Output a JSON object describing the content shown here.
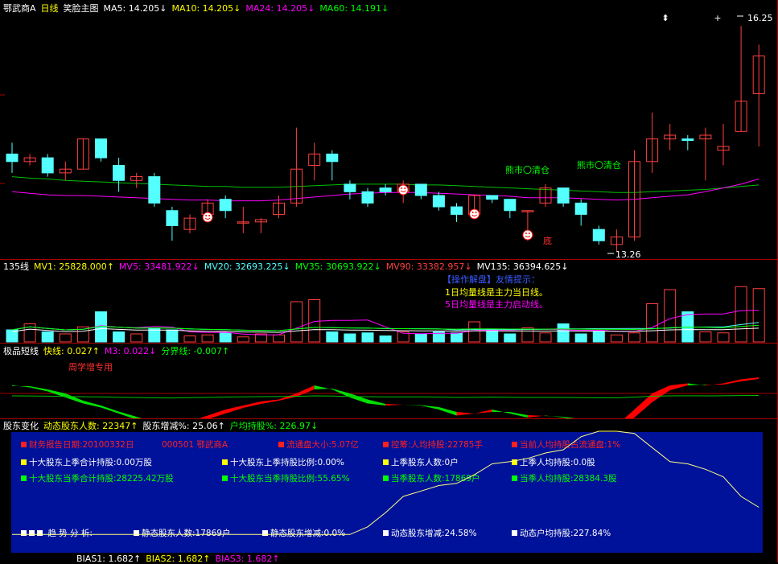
{
  "main": {
    "stock": "鄂武商A",
    "period": "日线",
    "indicator": "笑脸主图",
    "ma": [
      {
        "label": "MA5: 14.205↓",
        "color": "#ffffff"
      },
      {
        "label": "MA10: 14.205↓",
        "color": "#ffff00"
      },
      {
        "label": "MA24: 14.205↓",
        "color": "#ff00ff"
      },
      {
        "label": "MA60: 14.191↓",
        "color": "#00ff00"
      }
    ],
    "high_label": "16.25",
    "low_label": "13.26",
    "annotations": [
      "熊市〇清仓",
      "熊市〇清仓",
      "底"
    ],
    "colors": {
      "up": "#ff4040",
      "down": "#54ffff",
      "ma24": "#ff00ff",
      "ma60": "#00c000"
    }
  },
  "volume": {
    "title": "135线",
    "mv": [
      {
        "label": "MV1: 25828.000↑",
        "color": "#ffff00"
      },
      {
        "label": "MV5: 33481.922↓",
        "color": "#ff00ff"
      },
      {
        "label": "MV20: 32693.225↓",
        "color": "#54ffff"
      },
      {
        "label": "MV35: 30693.922↓",
        "color": "#00ff00"
      },
      {
        "label": "MV90: 33382.957↓",
        "color": "#ff4040"
      },
      {
        "label": "MV135: 36394.625↓",
        "color": "#ffffff"
      }
    ],
    "tips": [
      {
        "text": "【操作解盘】友情提示：",
        "color": "#3a5cff"
      },
      {
        "text": "1日均量线是主力当日线。",
        "color": "#ffff00"
      },
      {
        "text": "5日均量线是主力启动线。",
        "color": "#ff00ff"
      }
    ]
  },
  "oscillator": {
    "title": "极品短线",
    "fast": "快线: 0.027↑",
    "m3": "M3: 0.022↓",
    "divide": "分界线: -0.007↑",
    "note": "周学增专用"
  },
  "shareholder": {
    "title": "股东变化",
    "items": [
      {
        "text": "动态股东人数: 22347↑",
        "color": "#ffff00"
      },
      {
        "text": "股东增减%: 25.06↑",
        "color": "#ffffff"
      },
      {
        "text": "户均持股%: 226.97↓",
        "color": "#00ff00"
      }
    ],
    "row1": [
      {
        "text": "财务报告日期:20100332日",
        "color": "#ff2020"
      },
      {
        "text": "000501 鄂武商A",
        "color": "#ff2020"
      },
      {
        "text": "流通盘大小:5.07亿",
        "color": "#ff2020"
      },
      {
        "text": "控筹:人均持股:22785手",
        "color": "#ff2020"
      },
      {
        "text": "当前人均持股占流通盘:1%",
        "color": "#ff2020"
      }
    ],
    "row2": [
      {
        "text": "十大股东上季合计持股:0.00万股",
        "color": "#ffffff"
      },
      {
        "text": "十大股东上季持股比例:0.00%",
        "color": "#ffffff"
      },
      {
        "text": "上季股东人数:0户",
        "color": "#ffffff"
      },
      {
        "text": "上季人均持股:0.0股",
        "color": "#ffffff"
      }
    ],
    "row3": [
      {
        "text": "十大股东当季合计持股:28225.42万股",
        "color": "#00ff00"
      },
      {
        "text": "十大股东当季持股比例:55.65%",
        "color": "#00ff00"
      },
      {
        "text": "当季股东人数:17869户",
        "color": "#00ff00"
      },
      {
        "text": "当季人均持股:28384.3股",
        "color": "#00ff00"
      }
    ],
    "trend_label": "趋 势 分 析:",
    "row4": [
      {
        "text": "静态股东人数:17869户"
      },
      {
        "text": "静态股东增减:0.0%"
      },
      {
        "text": "动态股东增减:24.58%"
      },
      {
        "text": "动态户均持股:227.84%"
      }
    ],
    "bias": [
      {
        "text": "BIAS1: 1.682↑",
        "color": "#ffffff"
      },
      {
        "text": "BIAS2: 1.682↑",
        "color": "#ffff00"
      },
      {
        "text": "BIAS3: 1.682↑",
        "color": "#ff00ff"
      }
    ]
  },
  "chart_data": {
    "type": "candlestick",
    "candles": [
      {
        "o": 14.55,
        "c": 14.45,
        "h": 14.7,
        "l": 14.3
      },
      {
        "o": 14.45,
        "c": 14.5,
        "h": 14.55,
        "l": 14.4
      },
      {
        "o": 14.5,
        "c": 14.3,
        "h": 14.55,
        "l": 14.25
      },
      {
        "o": 14.3,
        "c": 14.35,
        "h": 14.45,
        "l": 14.2
      },
      {
        "o": 14.35,
        "c": 14.75,
        "h": 14.75,
        "l": 14.35
      },
      {
        "o": 14.75,
        "c": 14.5,
        "h": 14.75,
        "l": 14.45
      },
      {
        "o": 14.4,
        "c": 14.2,
        "h": 14.5,
        "l": 14.05
      },
      {
        "o": 14.2,
        "c": 14.25,
        "h": 14.3,
        "l": 14.1
      },
      {
        "o": 14.25,
        "c": 13.9,
        "h": 14.3,
        "l": 13.85
      },
      {
        "o": 13.8,
        "c": 13.6,
        "h": 13.85,
        "l": 13.4
      },
      {
        "o": 13.55,
        "c": 13.7,
        "h": 13.75,
        "l": 13.5
      },
      {
        "o": 13.75,
        "c": 13.9,
        "h": 13.95,
        "l": 13.7
      },
      {
        "o": 13.95,
        "c": 13.8,
        "h": 14.0,
        "l": 13.7
      },
      {
        "o": 13.65,
        "c": 13.65,
        "h": 13.85,
        "l": 13.5
      },
      {
        "o": 13.65,
        "c": 13.68,
        "h": 13.7,
        "l": 13.5
      },
      {
        "o": 13.75,
        "c": 13.9,
        "h": 14.0,
        "l": 13.7
      },
      {
        "o": 13.9,
        "c": 14.35,
        "h": 14.9,
        "l": 13.85
      },
      {
        "o": 14.4,
        "c": 14.55,
        "h": 14.7,
        "l": 14.2
      },
      {
        "o": 14.55,
        "c": 14.45,
        "h": 14.6,
        "l": 14.2
      },
      {
        "o": 14.15,
        "c": 14.05,
        "h": 14.2,
        "l": 13.95
      },
      {
        "o": 14.05,
        "c": 13.9,
        "h": 14.1,
        "l": 13.85
      },
      {
        "o": 14.1,
        "c": 14.05,
        "h": 14.15,
        "l": 14.0
      },
      {
        "o": 14.05,
        "c": 14.15,
        "h": 14.2,
        "l": 13.9
      },
      {
        "o": 14.15,
        "c": 14.0,
        "h": 14.15,
        "l": 13.95
      },
      {
        "o": 14.0,
        "c": 13.85,
        "h": 14.05,
        "l": 13.8
      },
      {
        "o": 13.85,
        "c": 13.75,
        "h": 13.9,
        "l": 13.65
      },
      {
        "o": 13.75,
        "c": 14.0,
        "h": 14.0,
        "l": 13.7
      },
      {
        "o": 14.0,
        "c": 13.95,
        "h": 14.0,
        "l": 13.9
      },
      {
        "o": 13.95,
        "c": 13.8,
        "h": 13.95,
        "l": 13.7
      },
      {
        "o": 13.8,
        "c": 13.8,
        "h": 13.8,
        "l": 13.4
      },
      {
        "o": 13.9,
        "c": 14.1,
        "h": 14.15,
        "l": 13.85
      },
      {
        "o": 14.1,
        "c": 13.9,
        "h": 14.1,
        "l": 13.85
      },
      {
        "o": 13.9,
        "c": 13.75,
        "h": 13.95,
        "l": 13.6
      },
      {
        "o": 13.55,
        "c": 13.4,
        "h": 13.6,
        "l": 13.35
      },
      {
        "o": 13.35,
        "c": 13.45,
        "h": 13.55,
        "l": 13.26
      },
      {
        "o": 13.45,
        "c": 14.45,
        "h": 14.6,
        "l": 13.4
      },
      {
        "o": 14.45,
        "c": 14.75,
        "h": 15.1,
        "l": 14.3
      },
      {
        "o": 14.75,
        "c": 14.8,
        "h": 14.95,
        "l": 14.6
      },
      {
        "o": 14.75,
        "c": 14.73,
        "h": 14.8,
        "l": 14.6
      },
      {
        "o": 14.75,
        "c": 14.8,
        "h": 14.9,
        "l": 14.2
      },
      {
        "o": 14.6,
        "c": 14.65,
        "h": 14.95,
        "l": 14.4
      },
      {
        "o": 14.85,
        "c": 15.25,
        "h": 16.25,
        "l": 14.85
      },
      {
        "o": 15.35,
        "c": 15.85,
        "h": 16.0,
        "l": 14.65
      }
    ],
    "ma24": [
      14.05,
      14.03,
      14.01,
      14.0,
      14.0,
      13.99,
      13.98,
      13.97,
      13.96,
      13.95,
      13.94,
      13.94,
      13.93,
      13.93,
      13.93,
      13.94,
      13.96,
      13.98,
      14.0,
      14.02,
      14.03,
      14.04,
      14.04,
      14.04,
      14.03,
      14.02,
      14.01,
      14.0,
      13.99,
      13.97,
      13.97,
      13.97,
      13.96,
      13.95,
      13.94,
      13.95,
      13.97,
      13.99,
      14.01,
      14.05,
      14.1,
      14.15,
      14.22
    ],
    "ma60": [
      14.25,
      14.23,
      14.22,
      14.2,
      14.19,
      14.18,
      14.17,
      14.16,
      14.15,
      14.14,
      14.13,
      14.12,
      14.12,
      14.11,
      14.11,
      14.11,
      14.12,
      14.13,
      14.14,
      14.15,
      14.15,
      14.15,
      14.15,
      14.14,
      14.14,
      14.13,
      14.12,
      14.11,
      14.1,
      14.09,
      14.08,
      14.07,
      14.06,
      14.05,
      14.04,
      14.04,
      14.05,
      14.06,
      14.07,
      14.08,
      14.1,
      14.12,
      14.14
    ],
    "ylim": [
      13.2,
      16.4
    ],
    "volume": [
      12,
      18,
      10,
      8,
      15,
      30,
      10,
      8,
      14,
      12,
      6,
      7,
      9,
      5,
      8,
      7,
      40,
      42,
      10,
      8,
      9,
      6,
      10,
      8,
      10,
      9,
      20,
      12,
      8,
      14,
      9,
      18,
      8,
      10,
      7,
      9,
      38,
      52,
      30,
      10,
      9,
      55,
      53
    ],
    "oscillator": [
      0.02,
      0.015,
      0.005,
      -0.01,
      -0.025,
      -0.035,
      -0.05,
      -0.065,
      -0.08,
      -0.085,
      -0.07,
      -0.055,
      -0.04,
      -0.03,
      -0.02,
      -0.015,
      0.0,
      0.02,
      0.01,
      -0.01,
      -0.025,
      -0.03,
      -0.028,
      -0.03,
      -0.04,
      -0.055,
      -0.05,
      -0.04,
      -0.05,
      -0.06,
      -0.055,
      -0.06,
      -0.07,
      -0.08,
      -0.08,
      -0.04,
      0.0,
      0.02,
      0.025,
      0.02,
      0.025,
      0.035,
      0.04
    ],
    "oscillator2": [
      0.018,
      0.018,
      0.01,
      0.0,
      -0.018,
      -0.03,
      -0.045,
      -0.058,
      -0.072,
      -0.082,
      -0.078,
      -0.064,
      -0.05,
      -0.036,
      -0.026,
      -0.018,
      -0.008,
      0.01,
      0.012,
      0.0,
      -0.015,
      -0.026,
      -0.028,
      -0.029,
      -0.034,
      -0.046,
      -0.05,
      -0.046,
      -0.046,
      -0.054,
      -0.056,
      -0.058,
      -0.064,
      -0.075,
      -0.08,
      -0.06,
      -0.022,
      0.008,
      0.02,
      0.022,
      0.022,
      0.03,
      0.036
    ],
    "shareholder_line": [
      0.05,
      0.05,
      0.05,
      0.05,
      0.05,
      0.05,
      0.05,
      0.05,
      0.05,
      0.05,
      0.05,
      0.05,
      0.05,
      0.05,
      0.05,
      0.05,
      0.05,
      0.05,
      0.05,
      0.05,
      0.12,
      0.25,
      0.4,
      0.45,
      0.5,
      0.52,
      0.6,
      0.7,
      0.72,
      0.75,
      0.8,
      0.83,
      0.95,
      1.0,
      1.0,
      0.98,
      0.85,
      0.72,
      0.7,
      0.65,
      0.58,
      0.4,
      0.3
    ]
  }
}
